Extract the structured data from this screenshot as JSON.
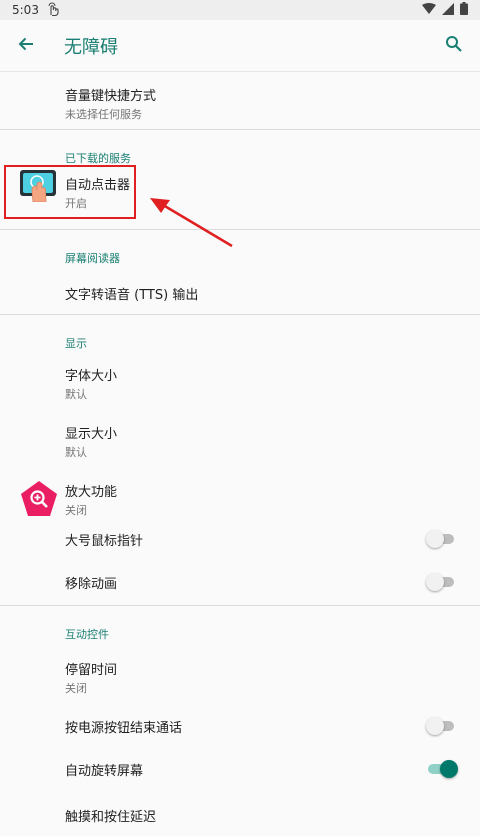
{
  "status_bar": {
    "time": "5:03"
  },
  "app_bar": {
    "title": "无障碍"
  },
  "items": {
    "volume_shortcut": {
      "title": "音量键快捷方式",
      "subtitle": "未选择任何服务"
    },
    "section_downloaded": "已下载的服务",
    "auto_clicker": {
      "title": "自动点击器",
      "subtitle": "开启"
    },
    "section_screen_reader": "屏幕阅读器",
    "tts": {
      "title": "文字转语音 (TTS) 输出"
    },
    "section_display": "显示",
    "font_size": {
      "title": "字体大小",
      "subtitle": "默认"
    },
    "display_size": {
      "title": "显示大小",
      "subtitle": "默认"
    },
    "magnification": {
      "title": "放大功能",
      "subtitle": "关闭"
    },
    "large_pointer": {
      "title": "大号鼠标指针",
      "enabled": false
    },
    "remove_animations": {
      "title": "移除动画",
      "enabled": false
    },
    "section_interaction": "互动控件",
    "dwell_time": {
      "title": "停留时间",
      "subtitle": "关闭"
    },
    "power_ends_call": {
      "title": "按电源按钮结束通话",
      "enabled": false
    },
    "auto_rotate": {
      "title": "自动旋转屏幕",
      "enabled": true
    },
    "touch_hold_delay": {
      "title": "触摸和按住延迟"
    }
  },
  "colors": {
    "accent": "#1a7f72",
    "annotation": "#e02020",
    "magnify_icon": "#e91e63"
  },
  "icons": {
    "back": "arrow-left-icon",
    "search": "search-icon",
    "auto_clicker": "auto-clicker-app-icon",
    "magnify": "magnify-icon"
  }
}
